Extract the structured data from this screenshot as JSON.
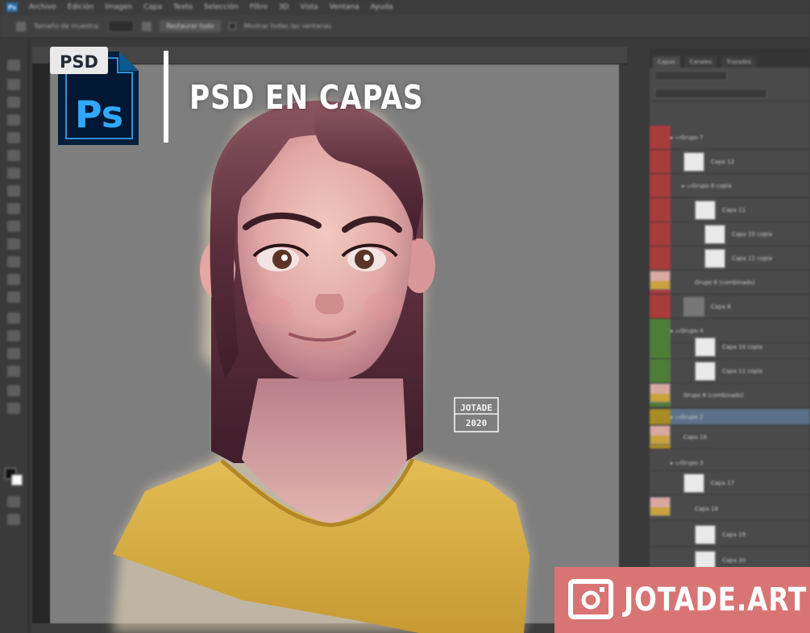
{
  "menu": {
    "app_icon": "Ps",
    "items": [
      "Archivo",
      "Edición",
      "Imagen",
      "Capa",
      "Texto",
      "Selección",
      "Filtro",
      "3D",
      "Vista",
      "Ventana",
      "Ayuda"
    ]
  },
  "options_bar": {
    "sample_label": "Tamaño de muestra:",
    "sample_value": "",
    "button_label": "Restaurar todo",
    "checkbox_label": "Mostrar todas las ventanas"
  },
  "document": {
    "tab_title": "",
    "status_left": "",
    "status_doc": ""
  },
  "layers_panel": {
    "tabs": [
      "Capas",
      "Canales",
      "Trazados"
    ],
    "filter_label": "",
    "blend_mode": "",
    "opacity_label": ""
  },
  "layers": [
    {
      "name": "Grupo 7",
      "type": "group",
      "color": "red"
    },
    {
      "name": "Capa 12",
      "type": "layer",
      "color": "red"
    },
    {
      "name": "Grupo 6 copia",
      "type": "group",
      "color": "red"
    },
    {
      "name": "Capa 11",
      "type": "layer",
      "color": "red"
    },
    {
      "name": "Capa 10 copia",
      "type": "layer",
      "color": "red"
    },
    {
      "name": "Capa 11 copia",
      "type": "layer",
      "color": "red"
    },
    {
      "name": "Grupo 6 (combinado)",
      "type": "layer",
      "color": "red"
    },
    {
      "name": "Capa 8",
      "type": "layer",
      "color": "red"
    },
    {
      "name": "Grupo 4",
      "type": "group",
      "color": "green"
    },
    {
      "name": "Capa 10 copia",
      "type": "layer",
      "color": "green"
    },
    {
      "name": "Capa 11 copia",
      "type": "layer",
      "color": "green"
    },
    {
      "name": "Grupo 6 (combinado)",
      "type": "layer",
      "color": "green"
    },
    {
      "name": "Grupo 2",
      "type": "group",
      "color": "yellow",
      "selected": true
    },
    {
      "name": "Capa 16",
      "type": "layer",
      "color": "yellow"
    },
    {
      "name": "Grupo 3",
      "type": "group",
      "color": "none"
    },
    {
      "name": "Capa 17",
      "type": "layer",
      "color": "none"
    },
    {
      "name": "Capa 18",
      "type": "layer",
      "color": "none"
    },
    {
      "name": "Capa 19",
      "type": "layer",
      "color": "none"
    },
    {
      "name": "Capa 20",
      "type": "layer",
      "color": "none"
    }
  ],
  "overlay": {
    "logo_badge": "PSD",
    "logo_mark": "Ps",
    "headline": "PSD EN CAPAS",
    "brand_text": "JOTADE.ART",
    "signature_line1": "JOTADE",
    "signature_line2": "2020"
  },
  "colors": {
    "layer_red": "#a83b3b",
    "layer_green": "#4f7d38",
    "layer_yellow": "#a88b23",
    "brand_bg": "#d97475",
    "ps_blue": "#31a8ff",
    "canvas_gray": "#7e7e7e"
  },
  "icons": [
    "ps-file-icon",
    "camera-icon",
    "visibility-eye-icon",
    "folder-icon"
  ]
}
